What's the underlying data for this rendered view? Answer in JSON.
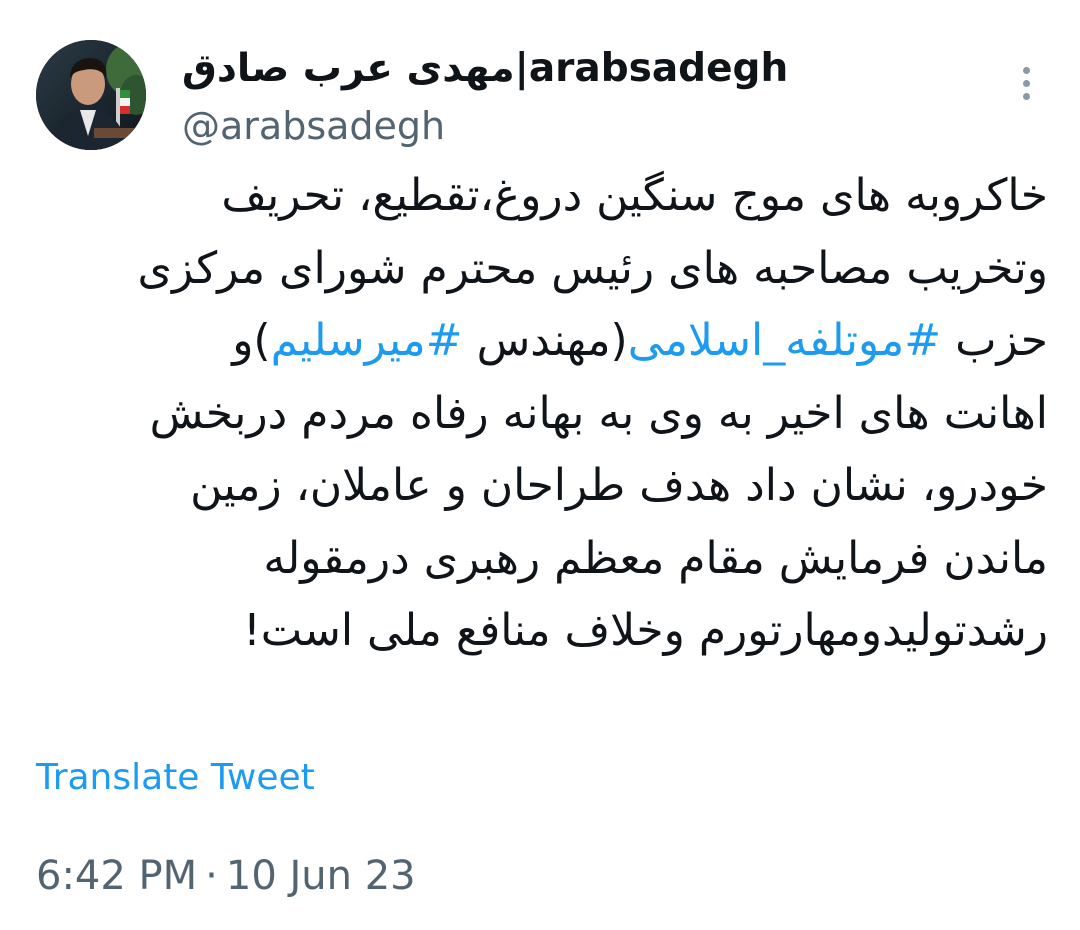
{
  "tweet": {
    "display_name": "مهدی عرب صادق|arabsadegh",
    "handle": "@arabsadegh",
    "avatar_icon": "profile-photo",
    "more_icon": "more-vertical-icon",
    "body": {
      "line1": "خاکروبه های موج سنگین دروغ،تقطیع، تحریف",
      "line2": "وتخریب مصاحبه های رئیس محترم شورای مرکزی",
      "line3_a": "حزب ",
      "hashtag1": "#موتلفه_اسلامی",
      "line3_b": "(مهندس ",
      "hashtag2": "#میرسلیم",
      "line3_c": ")و",
      "line4": "اهانت های اخیر به وی به بهانه رفاه مردم دربخش",
      "line5": "خودرو، نشان داد هدف طراحان و عاملان، زمین",
      "line6": "ماندن فرمایش مقام معظم رهبری درمقوله",
      "line7": "رشدتولیدومهارتورم وخلاف منافع ملی است!"
    },
    "translate_label": "Translate Tweet",
    "time": "6:42 PM",
    "separator": "·",
    "date": "10 Jun 23"
  },
  "colors": {
    "text": "#0f1419",
    "secondary": "#536471",
    "link": "#1d9bf0",
    "background": "#ffffff"
  }
}
